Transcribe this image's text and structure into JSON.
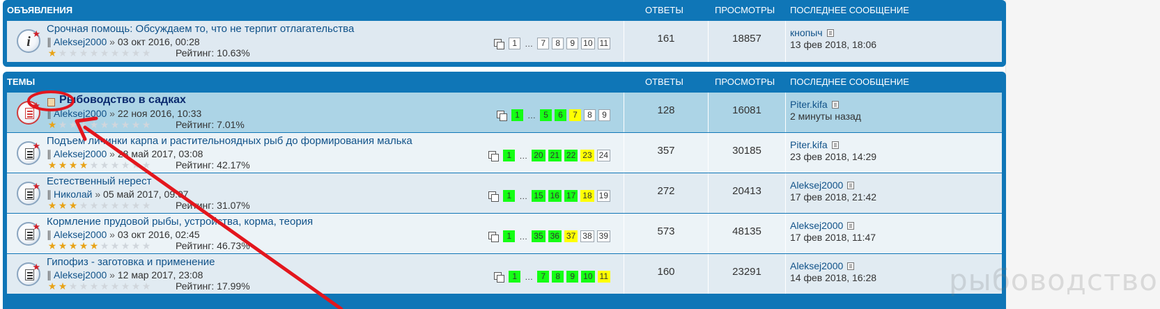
{
  "announcements": {
    "header": {
      "title": "ОБЪЯВЛЕНИЯ",
      "replies": "ОТВЕТЫ",
      "views": "ПРОСМОТРЫ",
      "last_post": "ПОСЛЕДНЕЕ СООБЩЕНИЕ"
    },
    "topics": [
      {
        "icon": "info-icon",
        "title": "Срочная помощь: Обсуждаем то, что не терпит отлагательства",
        "author": "Aleksej2000",
        "date": "03 окт 2016, 00:28",
        "rating_label": "Рейтинг: 10.63%",
        "rating_percent": 10.63,
        "pages": [
          {
            "n": "1",
            "c": ""
          },
          {
            "n": "…",
            "c": "dots"
          },
          {
            "n": "7",
            "c": ""
          },
          {
            "n": "8",
            "c": ""
          },
          {
            "n": "9",
            "c": ""
          },
          {
            "n": "10",
            "c": ""
          },
          {
            "n": "11",
            "c": ""
          }
        ],
        "replies": "161",
        "views": "18857",
        "last_author": "кнопыч",
        "last_time": "13 фев 2018, 18:06"
      }
    ]
  },
  "topics": {
    "header": {
      "title": "ТЕМЫ",
      "replies": "ОТВЕТЫ",
      "views": "ПРОСМОТРЫ",
      "last_post": "ПОСЛЕДНЕЕ СООБЩЕНИЕ"
    },
    "items": [
      {
        "title": "Рыбоводство в садках",
        "highlighted": true,
        "unread": true,
        "author": "Aleksej2000",
        "date": "22 ноя 2016, 10:33",
        "rating_label": "Рейтинг: 7.01%",
        "rating_percent": 7.01,
        "pages": [
          {
            "n": "1",
            "c": "g"
          },
          {
            "n": "…",
            "c": "dots"
          },
          {
            "n": "5",
            "c": "g"
          },
          {
            "n": "6",
            "c": "g"
          },
          {
            "n": "7",
            "c": "y"
          },
          {
            "n": "8",
            "c": ""
          },
          {
            "n": "9",
            "c": ""
          }
        ],
        "replies": "128",
        "views": "16081",
        "last_author": "Piter.kifa",
        "last_time": "2 минуты назад"
      },
      {
        "title": "Подъем личинки карпа и растительноядных рыб до формирования малька",
        "author": "Aleksej2000",
        "date": "28 май 2017, 03:08",
        "rating_label": "Рейтинг: 42.17%",
        "rating_percent": 42.17,
        "pages": [
          {
            "n": "1",
            "c": "g"
          },
          {
            "n": "…",
            "c": "dots"
          },
          {
            "n": "20",
            "c": "g"
          },
          {
            "n": "21",
            "c": "g"
          },
          {
            "n": "22",
            "c": "g"
          },
          {
            "n": "23",
            "c": "y"
          },
          {
            "n": "24",
            "c": ""
          }
        ],
        "replies": "357",
        "views": "30185",
        "last_author": "Piter.kifa",
        "last_time": "23 фев 2018, 14:29"
      },
      {
        "title": "Естественный нерест",
        "author": "Николай",
        "date": "05 май 2017, 09:07",
        "rating_label": "Рейтинг: 31.07%",
        "rating_percent": 31.07,
        "pages": [
          {
            "n": "1",
            "c": "g"
          },
          {
            "n": "…",
            "c": "dots"
          },
          {
            "n": "15",
            "c": "g"
          },
          {
            "n": "16",
            "c": "g"
          },
          {
            "n": "17",
            "c": "g"
          },
          {
            "n": "18",
            "c": "y"
          },
          {
            "n": "19",
            "c": ""
          }
        ],
        "replies": "272",
        "views": "20413",
        "last_author": "Aleksej2000",
        "last_time": "17 фев 2018, 21:42"
      },
      {
        "title": "Кормление прудовой рыбы, устройства, корма, теория",
        "author": "Aleksej2000",
        "date": "03 окт 2016, 02:45",
        "rating_label": "Рейтинг: 46.73%",
        "rating_percent": 46.73,
        "pages": [
          {
            "n": "1",
            "c": "g"
          },
          {
            "n": "…",
            "c": "dots"
          },
          {
            "n": "35",
            "c": "g"
          },
          {
            "n": "36",
            "c": "g"
          },
          {
            "n": "37",
            "c": "y"
          },
          {
            "n": "38",
            "c": ""
          },
          {
            "n": "39",
            "c": ""
          }
        ],
        "replies": "573",
        "views": "48135",
        "last_author": "Aleksej2000",
        "last_time": "17 фев 2018, 11:47"
      },
      {
        "title": "Гипофиз - заготовка и применение",
        "author": "Aleksej2000",
        "date": "12 мар 2017, 23:08",
        "rating_label": "Рейтинг: 17.99%",
        "rating_percent": 17.99,
        "pages": [
          {
            "n": "1",
            "c": "g"
          },
          {
            "n": "…",
            "c": "dots"
          },
          {
            "n": "7",
            "c": "g"
          },
          {
            "n": "8",
            "c": "g"
          },
          {
            "n": "9",
            "c": "g"
          },
          {
            "n": "10",
            "c": "g"
          },
          {
            "n": "11",
            "c": "y"
          }
        ],
        "replies": "160",
        "views": "23291",
        "last_author": "Aleksej2000",
        "last_time": "14 фев 2018, 16:28"
      }
    ]
  },
  "watermark": "рыбоводство.com",
  "colors": {
    "header_bg": "#0f76b7",
    "row_alt1": "#e1ebf2",
    "row_alt2": "#ecf3f7",
    "row_highlight": "#acd4e6",
    "page_new": "#14ff14",
    "page_current": "#ffff00",
    "annotation": "#e3161d"
  }
}
